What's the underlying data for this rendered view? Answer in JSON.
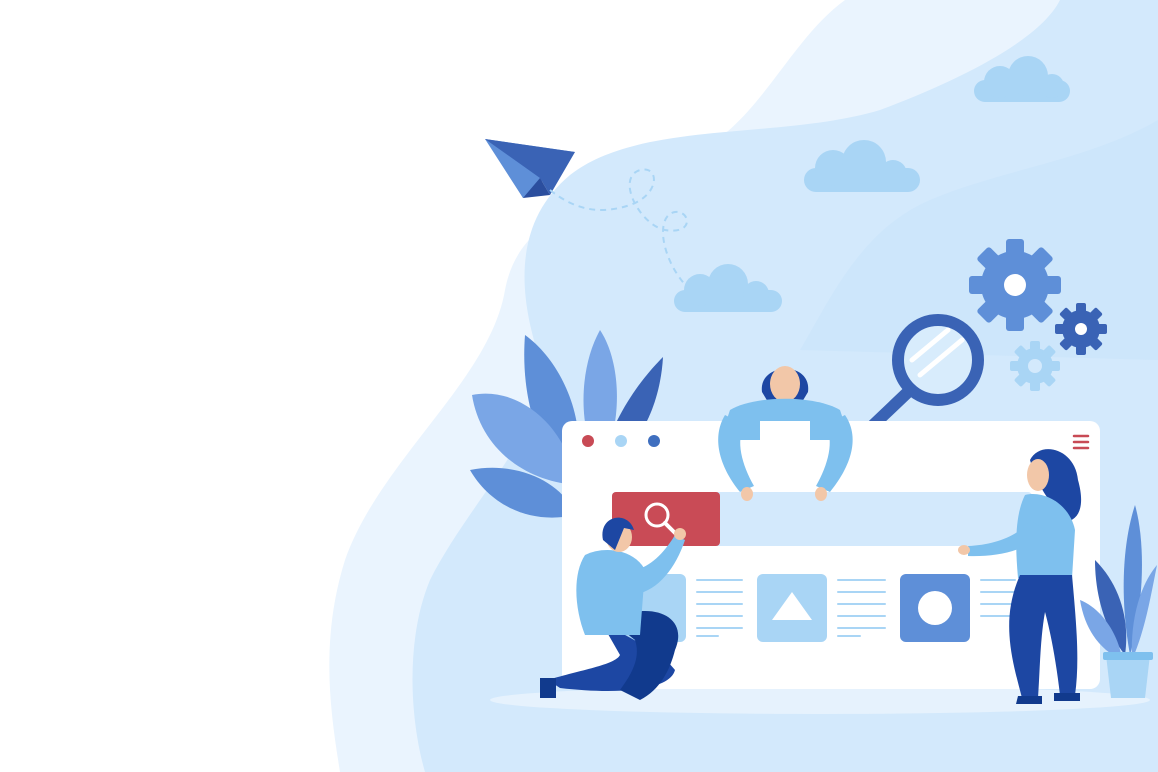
{
  "illustration": {
    "subject": "team-searching-website",
    "people_count": 3,
    "icons": [
      "paper-plane-icon",
      "cloud-icon",
      "gear-icon",
      "magnifier-icon",
      "menu-icon",
      "image-placeholder-icon",
      "triangle-icon",
      "circle-icon",
      "plant-icon"
    ]
  },
  "browser_window": {
    "dots": [
      "#c84a55",
      "#a9d5f5",
      "#3f6fbf"
    ],
    "menu_icon_color": "#c84a55",
    "search_button_color": "#c94b56"
  },
  "palette": {
    "background": "#ffffff",
    "blob_light": "#eaf4fe",
    "blob_mid": "#cde6fb",
    "cloud": "#a9d5f5",
    "gear_light": "#a9d5f5",
    "gear_mid": "#5e8fd8",
    "gear_dark": "#3a63b5",
    "navy": "#1d47a3",
    "sky": "#7ec0ee",
    "red": "#c94b56",
    "skin": "#f2c7a8"
  }
}
